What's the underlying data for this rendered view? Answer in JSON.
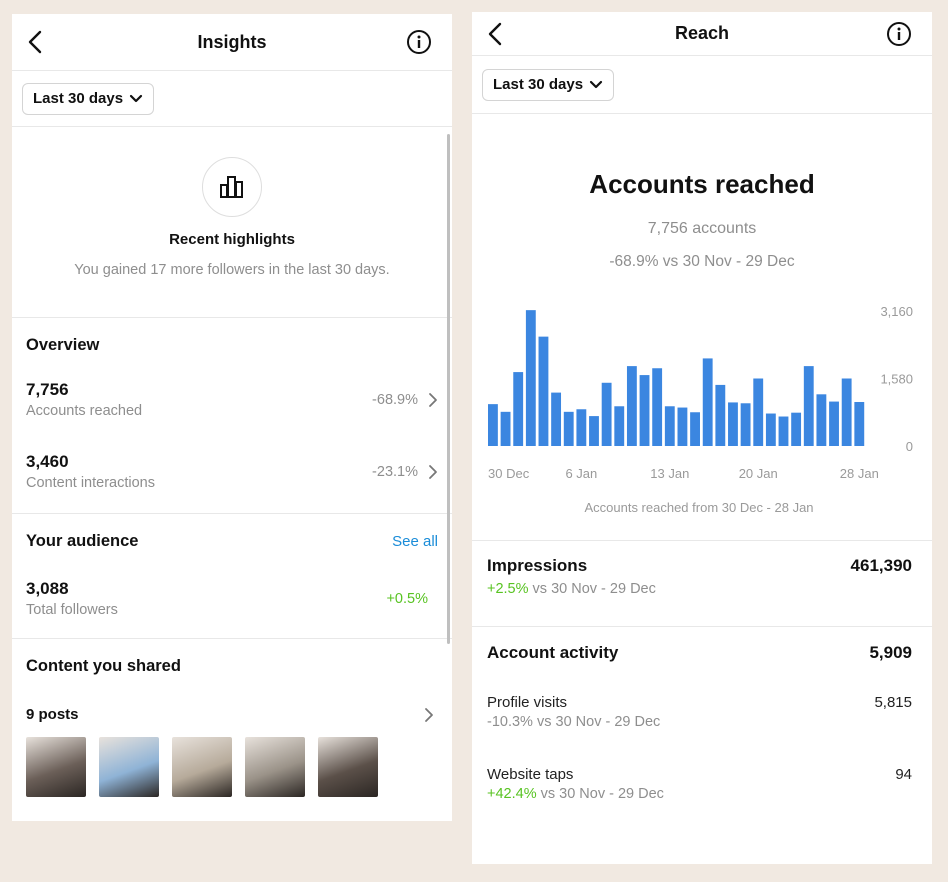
{
  "left": {
    "header": {
      "title": "Insights"
    },
    "filter": {
      "label": "Last 30 days"
    },
    "highlights": {
      "title": "Recent highlights",
      "text": "You gained 17 more followers in the last 30 days."
    },
    "overview": {
      "title": "Overview",
      "items": [
        {
          "value": "7,756",
          "label": "Accounts reached",
          "change": "-68.9%"
        },
        {
          "value": "3,460",
          "label": "Content interactions",
          "change": "-23.1%"
        }
      ]
    },
    "audience": {
      "title": "Your audience",
      "see_all": "See all",
      "value": "3,088",
      "label": "Total followers",
      "change": "+0.5%"
    },
    "content": {
      "title": "Content you shared",
      "posts": "9 posts",
      "thumbs": [
        {
          "name": "post-thumbnail-1",
          "bg": "#6b5f58"
        },
        {
          "name": "post-thumbnail-2",
          "bg": "#8fb3d6"
        },
        {
          "name": "post-thumbnail-3",
          "bg": "#b6aa9a"
        },
        {
          "name": "post-thumbnail-4",
          "bg": "#9a9288"
        },
        {
          "name": "post-thumbnail-5",
          "bg": "#5b5049"
        }
      ]
    }
  },
  "right": {
    "header": {
      "title": "Reach"
    },
    "filter": {
      "label": "Last 30 days"
    },
    "accounts_reached": {
      "title": "Accounts reached",
      "count": "7,756 accounts",
      "change": "-68.9% vs 30 Nov - 29 Dec"
    },
    "chart_caption": "Accounts reached from 30 Dec - 28 Jan",
    "impressions": {
      "title": "Impressions",
      "value": "461,390",
      "change": "+2.5%",
      "period": " vs 30 Nov - 29 Dec"
    },
    "activity": {
      "title": "Account activity",
      "value": "5,909",
      "items": [
        {
          "label": "Profile visits",
          "value": "5,815",
          "change": "-10.3%",
          "period": " vs 30 Nov - 29 Dec",
          "positive": false
        },
        {
          "label": "Website taps",
          "value": "94",
          "change": "+42.4%",
          "period": " vs 30 Nov - 29 Dec",
          "positive": true
        }
      ]
    }
  },
  "colors": {
    "bar": "#3b86e0",
    "positive": "#58c322",
    "link": "#1a8cd8",
    "muted": "#8e8e8e"
  },
  "chart_data": {
    "type": "bar",
    "ylim": [
      0,
      3160
    ],
    "yticks": [
      "3,160",
      "1,580",
      "0"
    ],
    "xticks": [
      "30 Dec",
      "6 Jan",
      "13 Jan",
      "20 Jan",
      "28 Jan"
    ],
    "values": [
      980,
      800,
      1730,
      3180,
      2560,
      1250,
      800,
      860,
      700,
      1480,
      930,
      1870,
      1660,
      1820,
      930,
      900,
      790,
      2050,
      1430,
      1020,
      1000,
      1580,
      760,
      690,
      780,
      1870,
      1210,
      1040,
      1580,
      1030
    ]
  }
}
